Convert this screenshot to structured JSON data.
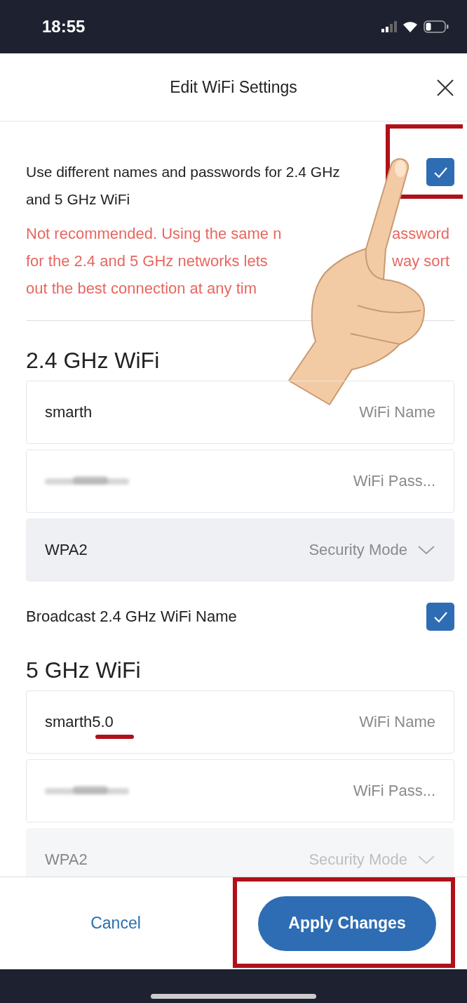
{
  "status_bar": {
    "time": "18:55"
  },
  "header": {
    "title": "Edit WiFi Settings"
  },
  "separate_names": {
    "label": "Use different names and passwords for 2.4 GHz and 5 GHz WiFi",
    "checked": true,
    "highlighted": true,
    "warning_lines": [
      [
        "Not recommended. Using the same n",
        "assword"
      ],
      [
        "for the 2.4 and 5 GHz networks lets",
        "way sort"
      ],
      [
        "out the best connection at any tim"
      ]
    ]
  },
  "networks": [
    {
      "title": "2.4 GHz WiFi",
      "name": {
        "value": "smarth",
        "label": "WiFi Name",
        "underlined": false
      },
      "password": {
        "label": "WiFi Pass..."
      },
      "security": {
        "value": "WPA2",
        "label": "Security Mode",
        "faded": false
      },
      "broadcast": {
        "label": "Broadcast 2.4 GHz WiFi Name",
        "checked": true
      }
    },
    {
      "title": "5 GHz WiFi",
      "name": {
        "value": "smarth5.0",
        "label": "WiFi Name",
        "underlined": true
      },
      "password": {
        "label": "WiFi Pass..."
      },
      "security": {
        "value": "WPA2",
        "label": "Security Mode",
        "faded": true
      }
    }
  ],
  "footer": {
    "cancel": "Cancel",
    "apply": {
      "label": "Apply Changes",
      "highlighted": true
    }
  }
}
